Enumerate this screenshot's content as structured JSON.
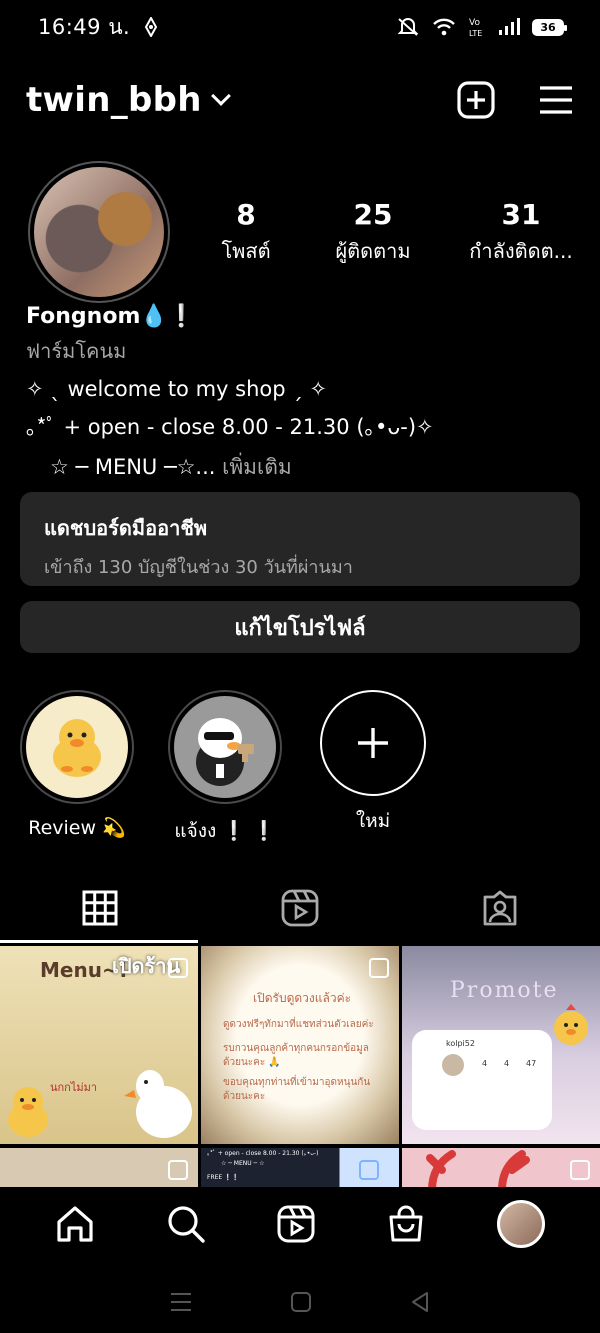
{
  "status": {
    "time": "16:49 น.",
    "battery": "36"
  },
  "header": {
    "username": "twin_bbh"
  },
  "stats": [
    {
      "value": "8",
      "label": "โพสต์"
    },
    {
      "value": "25",
      "label": "ผู้ติดตาม"
    },
    {
      "value": "31",
      "label": "กำลังติดต..."
    }
  ],
  "bio": {
    "name": "Fongnom💧❕",
    "category": "ฟาร์มโคนม",
    "line1": "✧ ˎ welcome to my shop ˏ ✧",
    "line2": "｡*ﾟ + open - close 8.00 - 21.30 (｡•ᴗ-)✧",
    "line3": "☆ ─  MENU ─☆...",
    "more": "เพิ่มเติม"
  },
  "dashboard": {
    "title": "แดชบอร์ดมืออาชีพ",
    "subtitle": "เข้าถึง 130 บัญชีในช่วง 30 วันที่ผ่านมา"
  },
  "edit_profile": "แก้ไขโปรไฟล์",
  "highlights": [
    {
      "label": "Review 💫"
    },
    {
      "label": "แจ้งง ❕ ❕"
    },
    {
      "label": "ใหม่"
    }
  ],
  "grid": {
    "tile1": {
      "text_a": "Menu~!",
      "text_b": "เปิดร้าน",
      "text_c": "นกกไม่มา"
    },
    "tile2": {
      "text_a": "เปิดรับดูดวงแล้วค่ะ",
      "text_b": "ดูดวงฟรีๆทักมาที่แชทส่วนตัวเลยค่ะ",
      "text_c": "รบกวนคุณลูกค้าทุกคนกรอกข้อมูลด้วยนะคะ 🙏",
      "text_d": "ขอบคุณทุกท่านที่เข้ามาอุดหนุนกันด้วยนะคะ"
    },
    "tile3": {
      "text_a": "Promote",
      "text_b": "kolpi52",
      "text_c": "4",
      "text_d": "4",
      "text_e": "47"
    },
    "tile5": {
      "text_a": "｡*ﾟ + open - close 8.00 - 21.30 (｡•ᴗ-)",
      "text_b": "☆ ─ MENU ─ ☆",
      "text_c": "FREE ❕❕"
    }
  },
  "colors": {
    "background": "#000000",
    "card": "#262626",
    "muted": "#a8a8a8"
  }
}
